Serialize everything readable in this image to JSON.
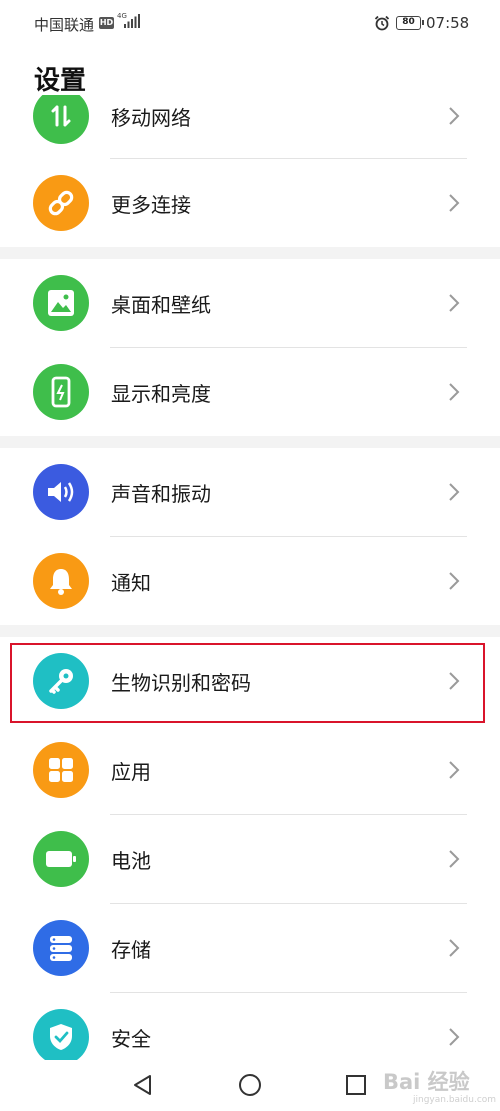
{
  "status_bar": {
    "carrier": "中国联通",
    "hd_badge": "HD",
    "network_type": "4G",
    "battery_level": "80",
    "time": "07:58"
  },
  "header": {
    "title": "设置"
  },
  "settings_items": [
    {
      "label": "移动网络",
      "icon": "data-arrows-icon",
      "color": "#3fbe4b"
    },
    {
      "label": "更多连接",
      "icon": "link-icon",
      "color": "#f99a14"
    },
    {
      "label": "桌面和壁纸",
      "icon": "image-icon",
      "color": "#3fbe4b"
    },
    {
      "label": "显示和亮度",
      "icon": "phone-brightness-icon",
      "color": "#3fbe4b"
    },
    {
      "label": "声音和振动",
      "icon": "speaker-icon",
      "color": "#3b5be0"
    },
    {
      "label": "通知",
      "icon": "bell-icon",
      "color": "#f99a14"
    },
    {
      "label": "生物识别和密码",
      "icon": "key-icon",
      "color": "#1fbfc4"
    },
    {
      "label": "应用",
      "icon": "apps-grid-icon",
      "color": "#f99a14"
    },
    {
      "label": "电池",
      "icon": "battery-icon",
      "color": "#3fbe4b"
    },
    {
      "label": "存储",
      "icon": "storage-icon",
      "color": "#2f6ce6"
    },
    {
      "label": "安全",
      "icon": "shield-check-icon",
      "color": "#1fbfc4"
    }
  ],
  "highlight_color": "#d9142b",
  "nav_bar": {
    "back": "back-icon",
    "home": "home-icon",
    "recents": "recents-icon"
  },
  "watermark": {
    "text": "Bai 经验",
    "subtext": "jingyan.baidu.com"
  }
}
